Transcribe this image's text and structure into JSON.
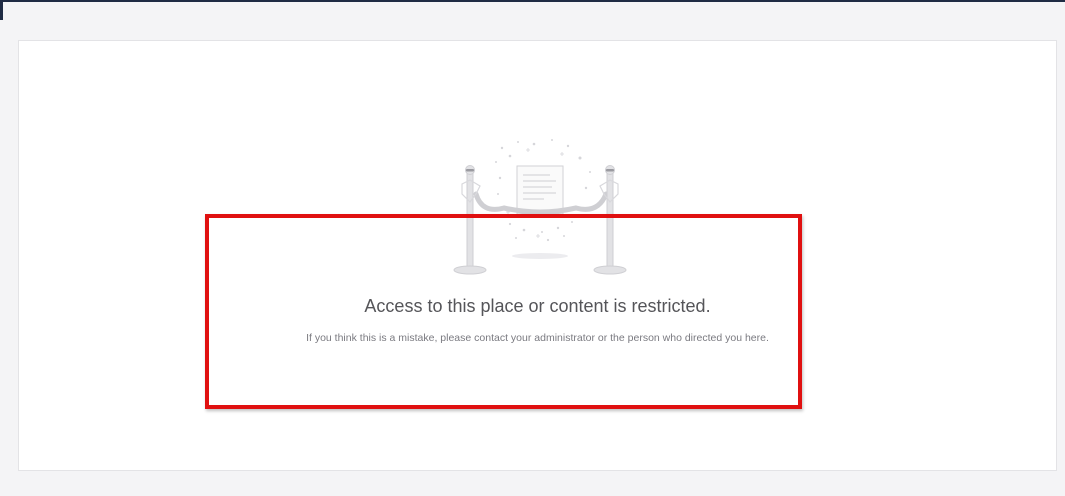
{
  "restricted": {
    "headline": "Access to this place or content is restricted.",
    "message": "If you think this is a mistake, please contact your administrator or the person who directed you here.",
    "illustration": "velvet-rope-restricted-icon"
  },
  "annotation": {
    "color": "#e01010"
  }
}
